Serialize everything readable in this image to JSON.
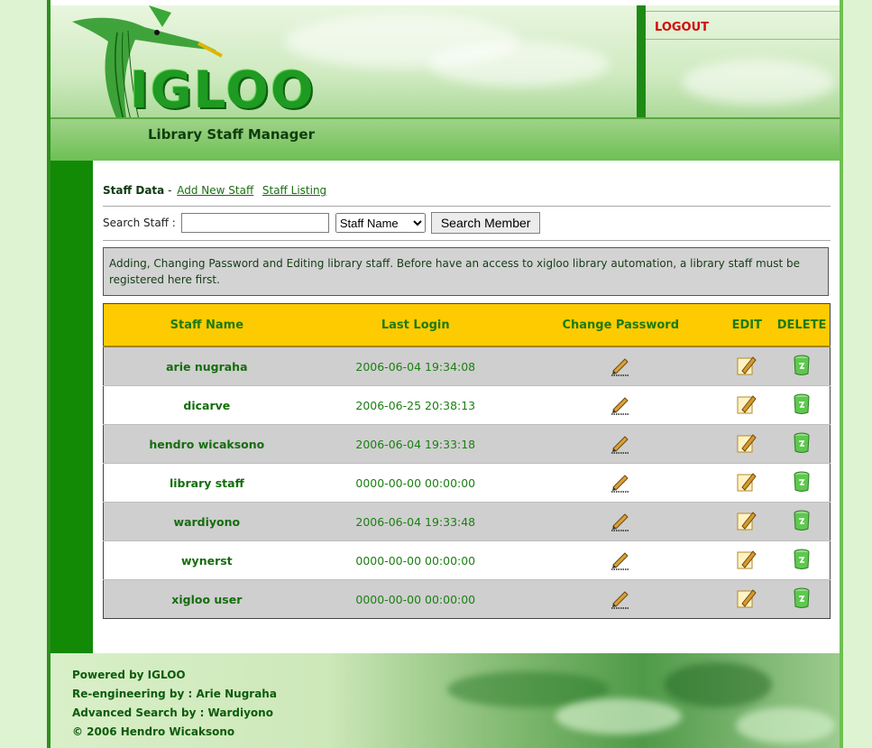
{
  "header": {
    "logo_text": "IGLOO",
    "subtitle": "Library Staff Manager",
    "logout_label": "LOGOUT"
  },
  "nav": {
    "section_label": "Staff Data",
    "separator": " - ",
    "add_link": "Add New Staff",
    "list_link": "Staff Listing"
  },
  "search": {
    "label": "Search Staff :",
    "input_value": "",
    "select_value": "Staff Name",
    "button_label": "Search Member"
  },
  "info_text": "Adding, Changing Password and Editing library staff. Before have an access to xigloo library automation, a library staff must be registered here first.",
  "table": {
    "headers": [
      "Staff Name",
      "Last Login",
      "Change Password",
      "EDIT",
      "DELETE"
    ],
    "rows": [
      {
        "name": "arie nugraha",
        "last_login": "2006-06-04 19:34:08"
      },
      {
        "name": "dicarve",
        "last_login": "2006-06-25 20:38:13"
      },
      {
        "name": "hendro wicaksono",
        "last_login": "2006-06-04 19:33:18"
      },
      {
        "name": "library staff",
        "last_login": "0000-00-00 00:00:00"
      },
      {
        "name": "wardiyono",
        "last_login": "2006-06-04 19:33:48"
      },
      {
        "name": "wynerst",
        "last_login": "0000-00-00 00:00:00"
      },
      {
        "name": "xigloo user",
        "last_login": "0000-00-00 00:00:00"
      }
    ]
  },
  "footer": {
    "lines": [
      "Powered by IGLOO",
      "Re-engineering by : Arie Nugraha",
      "Advanced Search by : Wardiyono",
      "© 2006 Hendro Wicaksono"
    ]
  },
  "colors": {
    "header_row": "#fecb00",
    "dark_green": "#128a06",
    "logout_red": "#d10b0b"
  },
  "icons": {
    "password": "pencil-icon",
    "edit": "edit-icon",
    "delete": "trash-icon"
  }
}
